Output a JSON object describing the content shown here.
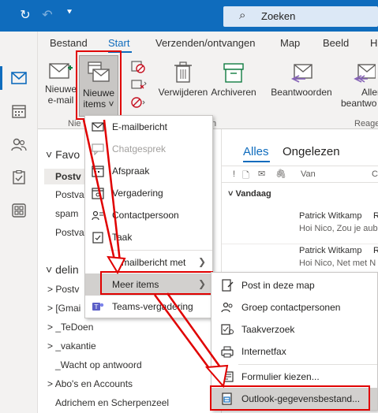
{
  "titlebar": {
    "search_label": "Zoeken"
  },
  "ribbon": {
    "tabs": [
      "Bestand",
      "Start",
      "Verzenden/ontvangen",
      "Map",
      "Beeld",
      "H"
    ],
    "active_tab": "Start",
    "buttons": {
      "new_email_1": "Nieuwe",
      "new_email_2": "e-mail",
      "new_items_1": "Nieuwe",
      "new_items_2": "items ˅",
      "delete": "Verwijderen",
      "archive": "Archiveren",
      "reply": "Beantwoorden",
      "reply_all_1": "Allen",
      "reply_all_2": "beantwo"
    },
    "group_labels": {
      "new": "Nie",
      "delete_suffix": "n",
      "respond": "Reage"
    }
  },
  "folders": {
    "favorites_header": "Favo",
    "favorites": [
      "Postv",
      "Postva",
      "spam",
      "Postva"
    ],
    "account_header": "delin",
    "account_items": [
      "Postv",
      "[Gmai",
      "_TeDoen",
      "_vakantie",
      "_Wacht op antwoord",
      "Abo's en Accounts",
      "Adrichem en Scherpenzeel"
    ]
  },
  "message_list": {
    "tab_all": "Alles",
    "tab_unread": "Ongelezen",
    "col_from": "Van",
    "col_extra": "C",
    "group_today": "Vandaag",
    "messages": [
      {
        "from": "Patrick Witkamp",
        "flag": "R",
        "preview": "Hoi Nico,  Zou je aub"
      },
      {
        "from": "Patrick Witkamp",
        "flag": "R",
        "preview": "Hoi Nico,  Net met N"
      }
    ]
  },
  "new_items_menu": {
    "items": [
      {
        "label": "E-mailbericht",
        "icon": "envelope-icon",
        "disabled": false,
        "submenu": false
      },
      {
        "label": "Chatgesprek",
        "icon": "chat-icon",
        "disabled": true,
        "submenu": false
      },
      {
        "label": "Afspraak",
        "icon": "calendar-icon",
        "disabled": false,
        "submenu": false
      },
      {
        "label": "Vergadering",
        "icon": "meeting-icon",
        "disabled": false,
        "submenu": false
      },
      {
        "label": "Contactpersoon",
        "icon": "contact-icon",
        "disabled": false,
        "submenu": false
      },
      {
        "label": "Taak",
        "icon": "task-icon",
        "disabled": false,
        "submenu": false
      },
      {
        "label": "E-mailbericht met",
        "icon": "",
        "disabled": false,
        "submenu": true
      },
      {
        "label": "Meer items",
        "icon": "",
        "disabled": false,
        "submenu": true,
        "highlighted": true
      },
      {
        "label": "Teams-vergadering",
        "icon": "teams-icon",
        "disabled": false,
        "submenu": false
      }
    ]
  },
  "more_items_submenu": {
    "items": [
      {
        "label": "Post in deze map",
        "icon": "post-icon"
      },
      {
        "label": "Groep contactpersonen",
        "icon": "contact-group-icon"
      },
      {
        "label": "Taakverzoek",
        "icon": "task-request-icon"
      },
      {
        "label": "Internetfax",
        "icon": "fax-icon"
      },
      {
        "label": "Formulier kiezen...",
        "icon": "form-icon"
      },
      {
        "label": "Outlook-gegevensbestand...",
        "icon": "data-file-icon",
        "highlighted": true
      }
    ]
  },
  "colors": {
    "brand": "#0f6cbd",
    "annotation_red": "#e00000",
    "menu_hover": "#d2d0ce"
  }
}
